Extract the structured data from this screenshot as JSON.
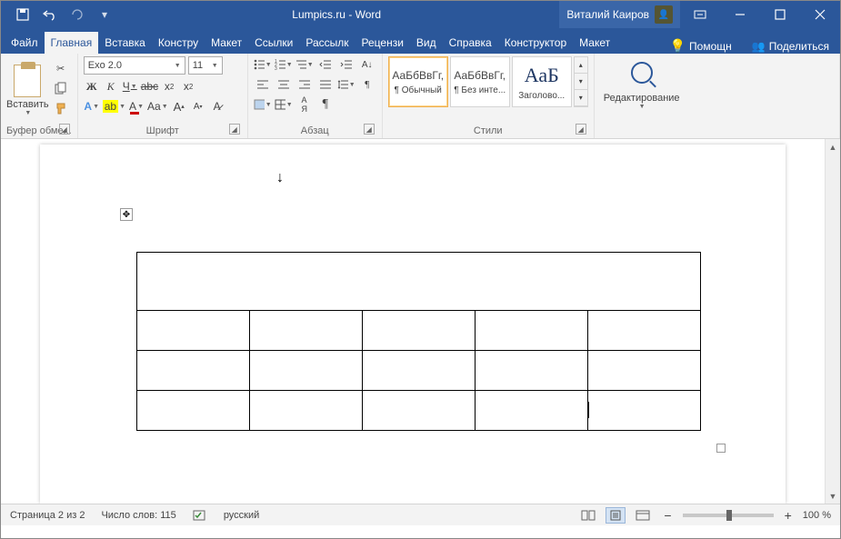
{
  "titlebar": {
    "title": "Lumpics.ru - Word",
    "user": "Виталий Каиров"
  },
  "tabs": {
    "file": "Файл",
    "home": "Главная",
    "insert": "Вставка",
    "design": "Констру",
    "layout": "Макет",
    "references": "Ссылки",
    "mailings": "Рассылк",
    "review": "Рецензи",
    "view": "Вид",
    "help": "Справка",
    "tbl_design": "Конструктор",
    "tbl_layout": "Макет",
    "help_label": "Помощн",
    "share": "Поделиться"
  },
  "ribbon": {
    "clipboard": {
      "paste": "Вставить",
      "label": "Буфер обме..."
    },
    "font": {
      "name": "Exo 2.0",
      "size": "11",
      "label": "Шрифт"
    },
    "paragraph": {
      "label": "Абзац"
    },
    "styles": {
      "label": "Стили",
      "sample": "АаБбВвГг,",
      "s1": "¶ Обычный",
      "s2": "¶ Без инте...",
      "sample3": "АаБ",
      "s3": "Заголово..."
    },
    "editing": {
      "label": "Редактирование"
    }
  },
  "status": {
    "page": "Страница 2 из 2",
    "words": "Число слов: 115",
    "lang": "русский",
    "zoom": "100 %"
  }
}
